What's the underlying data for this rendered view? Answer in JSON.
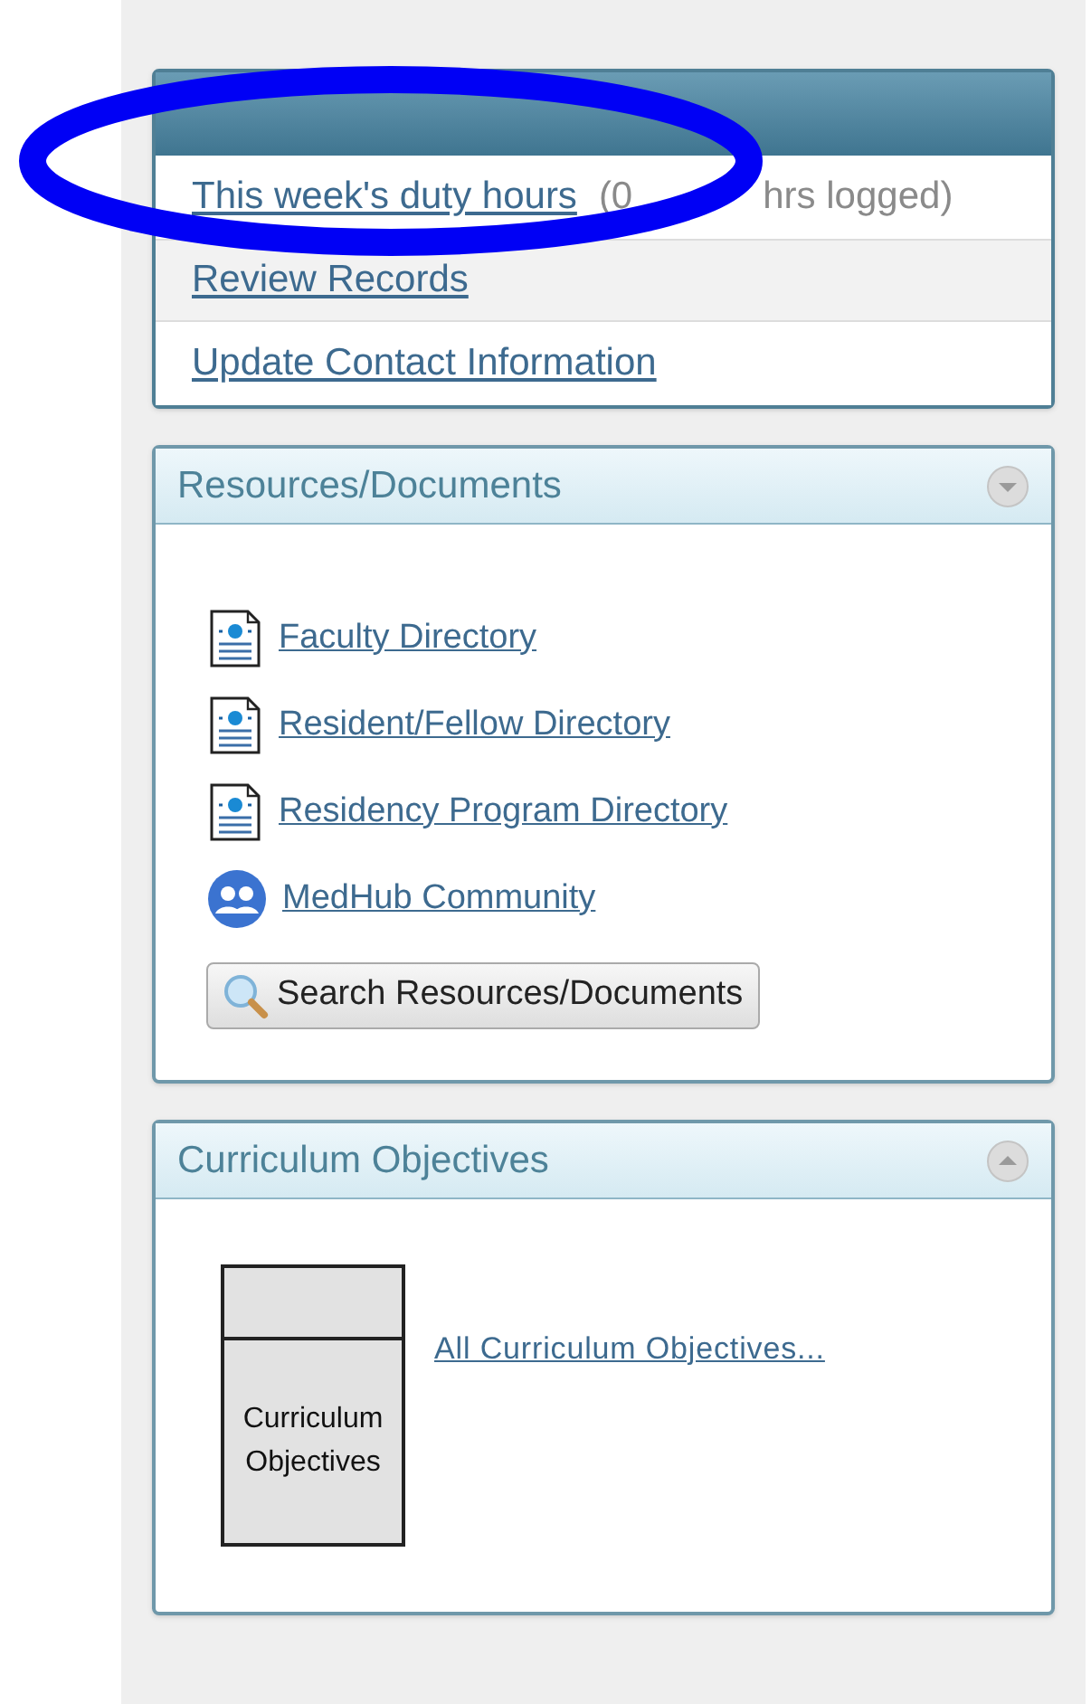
{
  "tasks": {
    "items": [
      {
        "label": "This week's duty hours",
        "note_parts": [
          "(0",
          "hrs logged)"
        ]
      },
      {
        "label": "Review Records"
      },
      {
        "label": "Update Contact Information"
      }
    ]
  },
  "resources": {
    "title": "Resources/Documents",
    "links": [
      {
        "kind": "document",
        "label": "Faculty Directory"
      },
      {
        "kind": "document",
        "label": "Resident/Fellow Directory"
      },
      {
        "kind": "document",
        "label": "Residency Program Directory"
      },
      {
        "kind": "community",
        "label": "MedHub Community"
      }
    ],
    "button": "Search Resources/Documents"
  },
  "curriculum": {
    "title": "Curriculum Objectives",
    "tile_label": "Curriculum Objectives",
    "link": "All Curriculum Objectives..."
  },
  "annotation": {
    "kind": "ellipse"
  }
}
